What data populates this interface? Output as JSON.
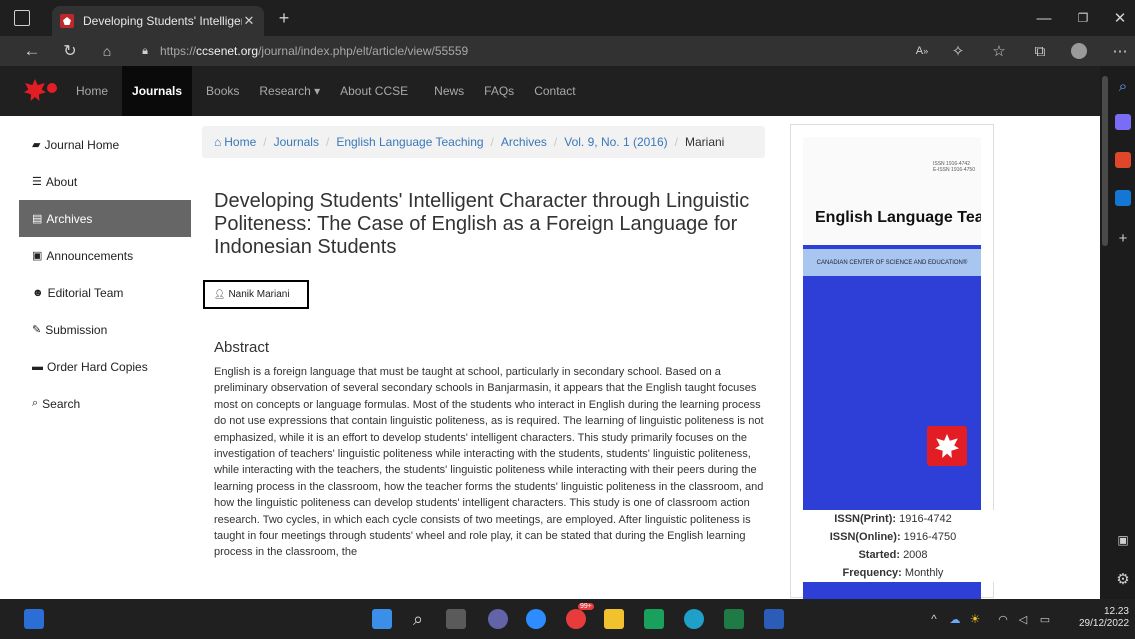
{
  "browser": {
    "tab_title": "Developing Students' Intelligent",
    "url_prefix": "https://",
    "url_domain": "ccsenet.org",
    "url_path": "/journal/index.php/elt/article/view/55559"
  },
  "site_nav": {
    "items": [
      "Home",
      "Journals",
      "Books",
      "Research ▾",
      "About CCSE",
      "News",
      "FAQs",
      "Contact"
    ],
    "active": "Journals"
  },
  "sidebar": {
    "items": [
      {
        "label": "Journal Home",
        "icon": "book-icon"
      },
      {
        "label": "About",
        "icon": "list-icon"
      },
      {
        "label": "Archives",
        "icon": "archive-icon"
      },
      {
        "label": "Announcements",
        "icon": "announcement-icon"
      },
      {
        "label": "Editorial Team",
        "icon": "team-icon"
      },
      {
        "label": "Submission",
        "icon": "edit-icon"
      },
      {
        "label": "Order Hard Copies",
        "icon": "cart-icon"
      },
      {
        "label": "Search",
        "icon": "search-icon"
      }
    ],
    "active": "Archives"
  },
  "breadcrumb": {
    "home": "Home",
    "journals": "Journals",
    "journal": "English Language Teaching",
    "archives": "Archives",
    "issue": "Vol. 9, No. 1 (2016)",
    "current": "Mariani"
  },
  "article": {
    "title": "Developing Students' Intelligent Character through Linguistic Politeness: The Case of English as a Foreign Language for Indonesian Students",
    "author": "Nanik Mariani",
    "abstract_heading": "Abstract",
    "abstract": "English is a foreign language that must be taught at school, particularly in secondary school. Based on a preliminary observation of several secondary schools in Banjarmasin, it appears that the English taught focuses most on concepts or language formulas. Most of the students who interact in English during the learning process do not use expressions that contain linguistic politeness, as is required. The learning of linguistic politeness is not emphasized, while it is an effort to develop students' intelligent characters. This study primarily focuses on the investigation of teachers' linguistic politeness while interacting with the students, students' linguistic politeness, while interacting with the teachers, the students' linguistic politeness while interacting with their peers during the learning process in the classroom, how the teacher forms the students' linguistic politeness in the classroom, and how the linguistic politeness can develop students' intelligent characters. This study is one of classroom action research. Two cycles, in which each cycle consists of two meetings, are employed. After linguistic politeness is taught in four meetings through students' wheel and role play, it can be stated that during the English learning process in the classroom, the"
  },
  "journal_info": {
    "cover_title": "English Language Teaching",
    "cover_band": "CANADIAN CENTER OF SCIENCE AND EDUCATION®",
    "issn_print_label": "ISSN(Print):",
    "issn_print": "1916-4742",
    "issn_online_label": "ISSN(Online):",
    "issn_online": "1916-4750",
    "started_label": "Started:",
    "started": "2008",
    "frequency_label": "Frequency:",
    "frequency": "Monthly"
  },
  "taskbar": {
    "time": "12.23",
    "date": "29/12/2022",
    "badge": "99+"
  },
  "colors": {
    "link": "#3a78b8",
    "brand_red": "#e21d24",
    "cover_blue": "#2d3fd6",
    "nav_bg": "#202020"
  }
}
